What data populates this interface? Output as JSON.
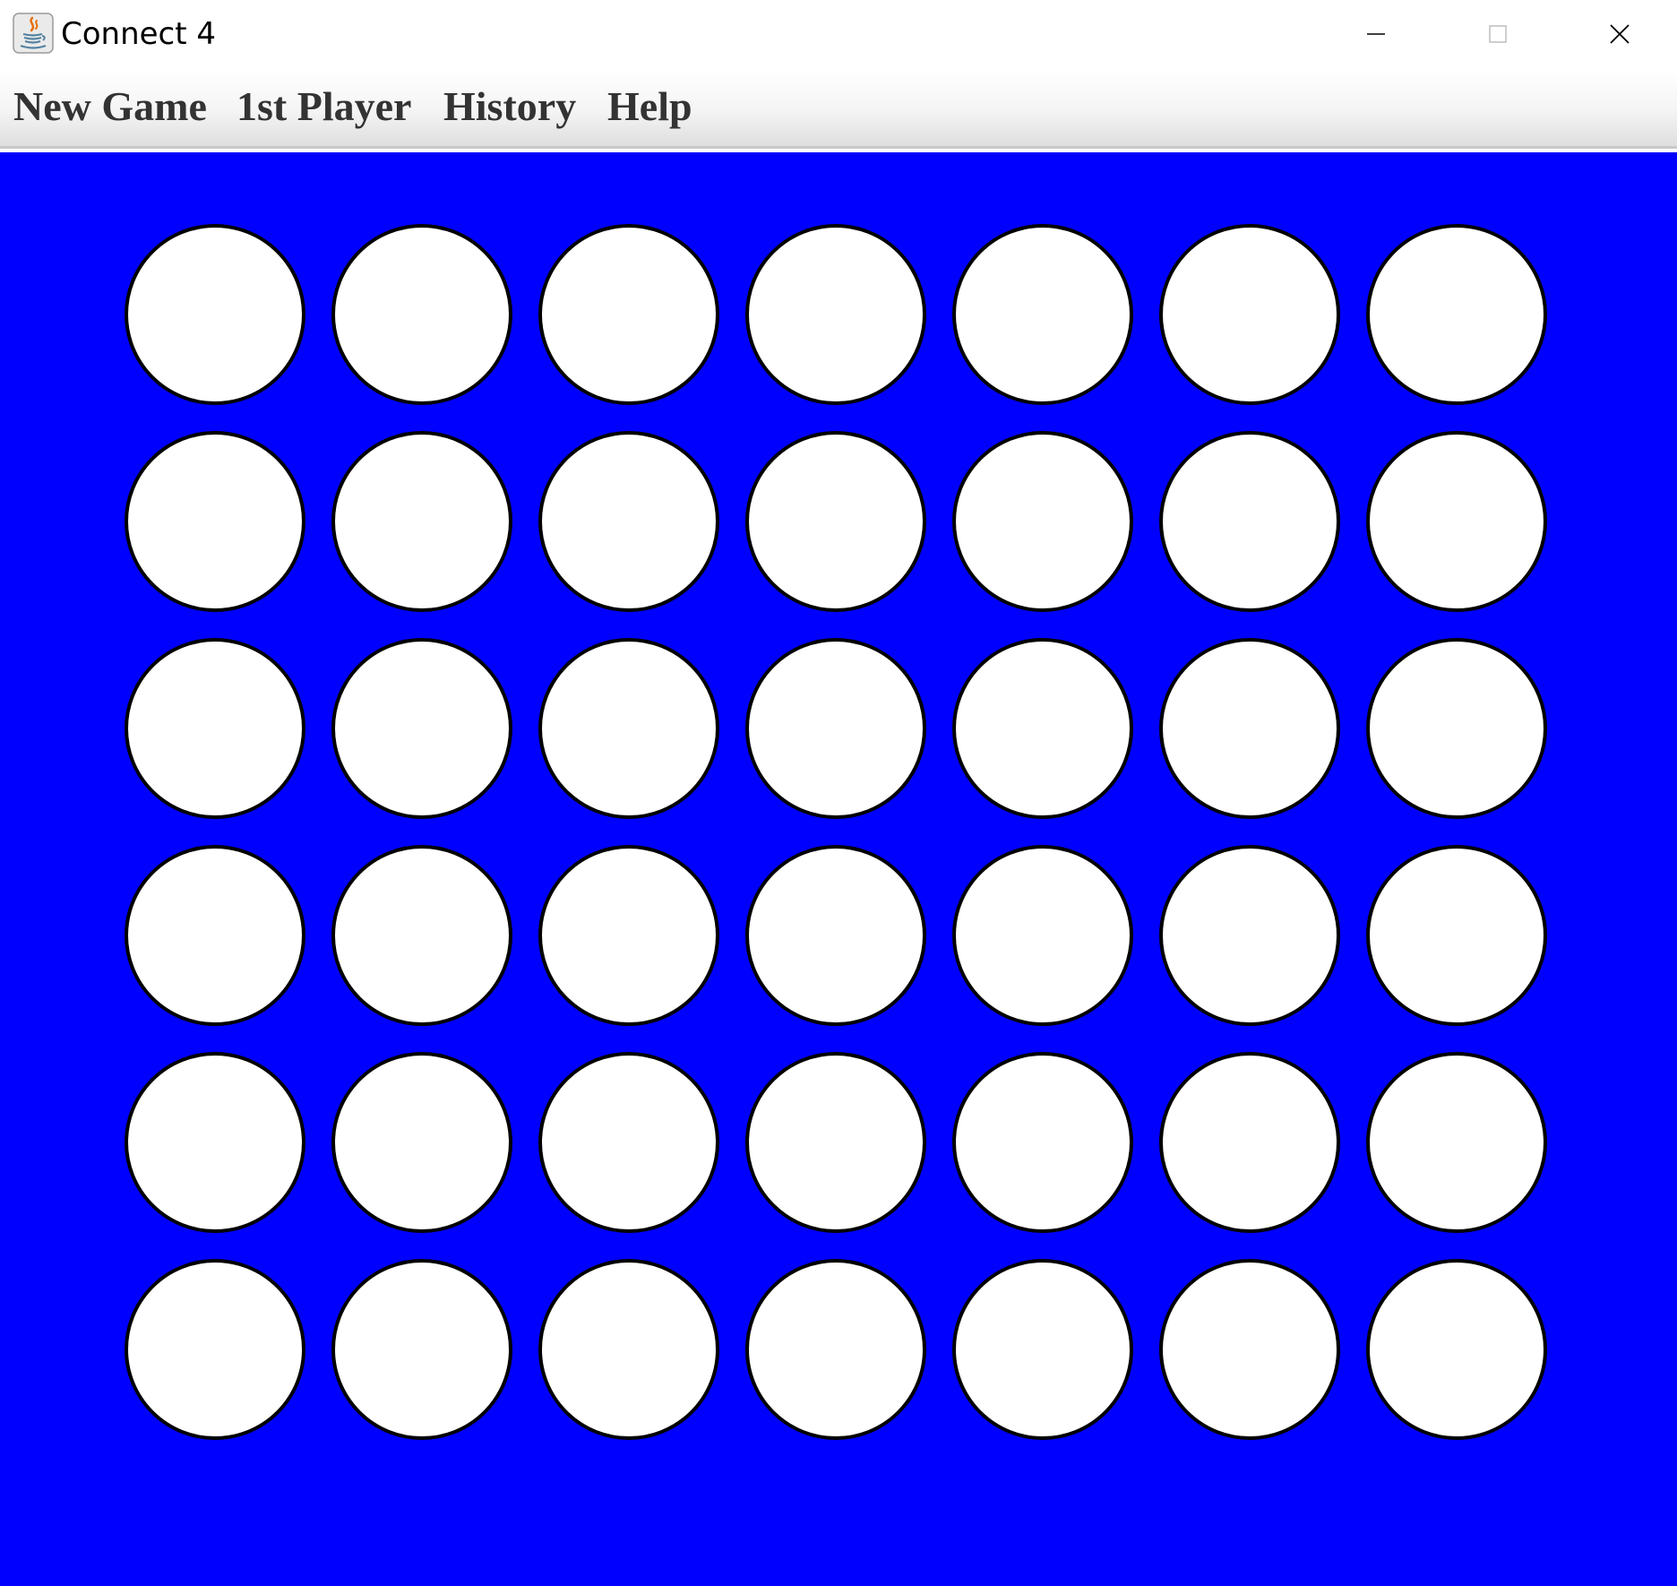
{
  "window": {
    "title": "Connect 4",
    "icon": "java-cup-icon",
    "controls": [
      "minimize-icon",
      "maximize-icon",
      "close-icon"
    ]
  },
  "menu": {
    "items": [
      {
        "label": "New Game"
      },
      {
        "label": "1st Player"
      },
      {
        "label": "History"
      },
      {
        "label": "Help"
      }
    ]
  },
  "board": {
    "columns": 7,
    "rows": 6,
    "board_color": "#0000ff",
    "empty_slot_color": "#ffffff",
    "slot_outline_color": "#000000",
    "cells": [
      [
        "empty",
        "empty",
        "empty",
        "empty",
        "empty",
        "empty",
        "empty"
      ],
      [
        "empty",
        "empty",
        "empty",
        "empty",
        "empty",
        "empty",
        "empty"
      ],
      [
        "empty",
        "empty",
        "empty",
        "empty",
        "empty",
        "empty",
        "empty"
      ],
      [
        "empty",
        "empty",
        "empty",
        "empty",
        "empty",
        "empty",
        "empty"
      ],
      [
        "empty",
        "empty",
        "empty",
        "empty",
        "empty",
        "empty",
        "empty"
      ],
      [
        "empty",
        "empty",
        "empty",
        "empty",
        "empty",
        "empty",
        "empty"
      ]
    ]
  }
}
